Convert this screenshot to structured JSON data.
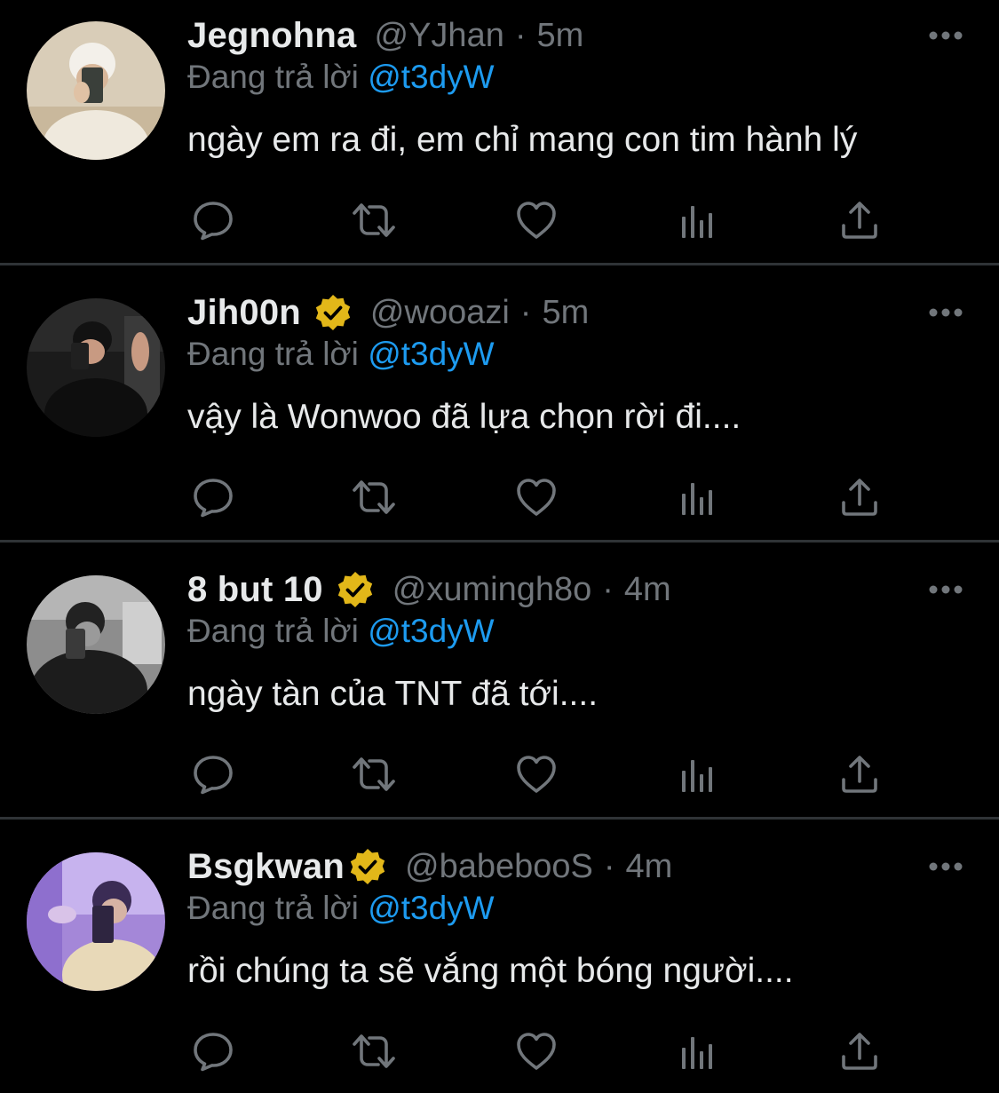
{
  "tweets": [
    {
      "display_name": "Jegnohna",
      "verified": false,
      "handle": "@YJhan",
      "separator": "·",
      "time": "5m",
      "reply_prefix": "Đang trả lời",
      "reply_to": "@t3dyW",
      "text": "ngày em ra đi, em chỉ mang con tim hành lý"
    },
    {
      "display_name": "Jih00n",
      "verified": true,
      "handle": "@wooazi",
      "separator": "·",
      "time": "5m",
      "reply_prefix": "Đang trả lời",
      "reply_to": "@t3dyW",
      "text": "vậy là Wonwoo đã lựa chọn rời đi...."
    },
    {
      "display_name": "8 but 10",
      "verified": true,
      "handle": "@xumingh8o",
      "separator": "·",
      "time": "4m",
      "reply_prefix": "Đang trả lời",
      "reply_to": "@t3dyW",
      "text": "ngày tàn của TNT đã tới...."
    },
    {
      "display_name": "Bsgkwan",
      "verified": true,
      "handle": "@babebooS",
      "separator": "·",
      "time": "4m",
      "reply_prefix": "Đang trả lời",
      "reply_to": "@t3dyW",
      "text": "rồi chúng ta sẽ vắng một bóng người...."
    }
  ],
  "icons": {
    "reply": "reply-icon",
    "retweet": "retweet-icon",
    "like": "heart-icon",
    "views": "views-icon",
    "share": "share-icon",
    "more": "more-icon",
    "verified": "verified-badge-icon"
  },
  "colors": {
    "background": "#000000",
    "text_primary": "#e7e9ea",
    "text_secondary": "#71767b",
    "mention": "#1d9bf0",
    "verified_badge": "#e2b719",
    "divider": "#2f3336"
  }
}
